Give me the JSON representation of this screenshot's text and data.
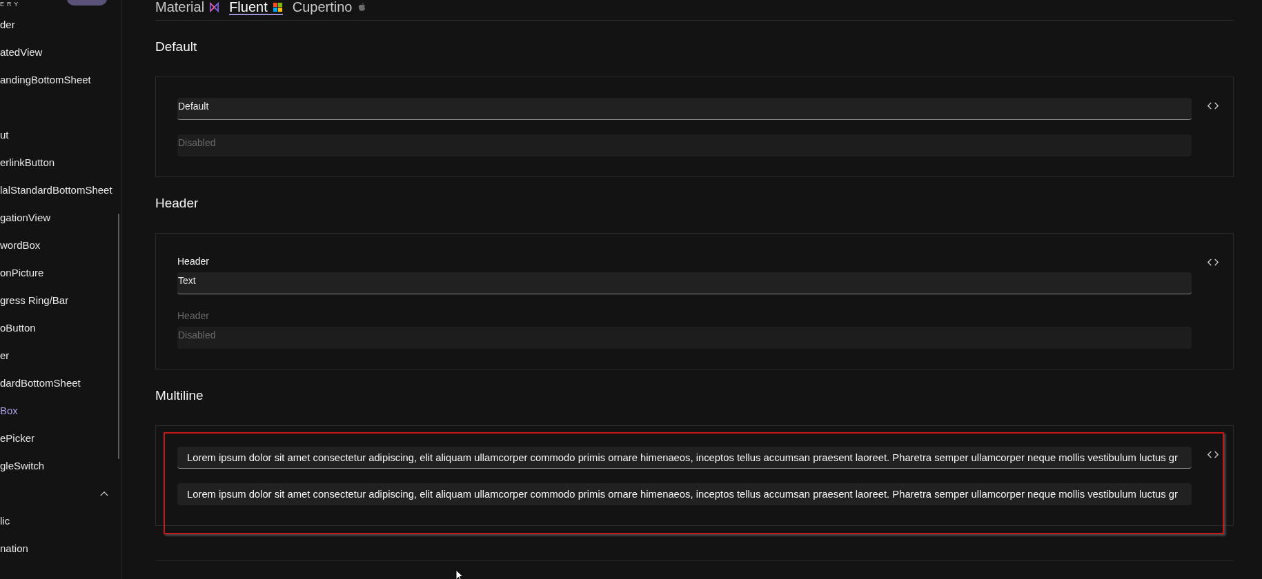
{
  "sidebar": {
    "caption": "ERY",
    "items": [
      {
        "kind": "item",
        "label": "der",
        "selected": false
      },
      {
        "kind": "item",
        "label": "atedView",
        "selected": false
      },
      {
        "kind": "item",
        "label": "andingBottomSheet",
        "selected": false
      },
      {
        "kind": "gap"
      },
      {
        "kind": "item",
        "label": "ut",
        "selected": false
      },
      {
        "kind": "item",
        "label": "erlinkButton",
        "selected": false
      },
      {
        "kind": "item",
        "label": "lalStandardBottomSheet",
        "selected": false
      },
      {
        "kind": "item",
        "label": "gationView",
        "selected": false
      },
      {
        "kind": "item",
        "label": "wordBox",
        "selected": false
      },
      {
        "kind": "item",
        "label": "onPicture",
        "selected": false
      },
      {
        "kind": "item",
        "label": "gress Ring/Bar",
        "selected": false
      },
      {
        "kind": "item",
        "label": "oButton",
        "selected": false
      },
      {
        "kind": "item",
        "label": "er",
        "selected": false
      },
      {
        "kind": "item",
        "label": "dardBottomSheet",
        "selected": false
      },
      {
        "kind": "item",
        "label": "Box",
        "selected": true
      },
      {
        "kind": "item",
        "label": "ePicker",
        "selected": false
      },
      {
        "kind": "item",
        "label": "gleSwitch",
        "selected": false
      },
      {
        "kind": "group",
        "expanded": true
      },
      {
        "kind": "item",
        "label": "lic",
        "selected": false
      },
      {
        "kind": "item",
        "label": "nation",
        "selected": false
      }
    ]
  },
  "tabs": [
    {
      "label": "Material",
      "selected": false
    },
    {
      "label": "Fluent",
      "selected": true
    },
    {
      "label": "Cupertino",
      "selected": false
    }
  ],
  "sections": [
    {
      "title": "Default",
      "fields": [
        {
          "kind": "plain",
          "value": "Default",
          "disabled": false
        },
        {
          "kind": "plain",
          "value": "Disabled",
          "disabled": true
        }
      ]
    },
    {
      "title": "Header",
      "fields": [
        {
          "kind": "plain",
          "header": "Header",
          "value": "Text",
          "disabled": false
        },
        {
          "kind": "plain",
          "header": "Header",
          "value": "Disabled",
          "disabled": true
        }
      ]
    },
    {
      "title": "Multiline",
      "highlighted": true,
      "fields": [
        {
          "kind": "multiline",
          "value": "Lorem ipsum dolor sit amet consectetur adipiscing, elit aliquam ullamcorper commodo primis ornare himenaeos, inceptos tellus accumsan praesent laoreet. Pharetra semper ullamcorper neque mollis vestibulum luctus gr",
          "read_only": false
        },
        {
          "kind": "multiline",
          "value": "Lorem ipsum dolor sit amet consectetur adipiscing, elit aliquam ullamcorper commodo primis ornare himenaeos, inceptos tellus accumsan praesent laoreet. Pharetra semper ullamcorper neque mollis vestibulum luctus gr",
          "read_only": true
        }
      ]
    }
  ]
}
